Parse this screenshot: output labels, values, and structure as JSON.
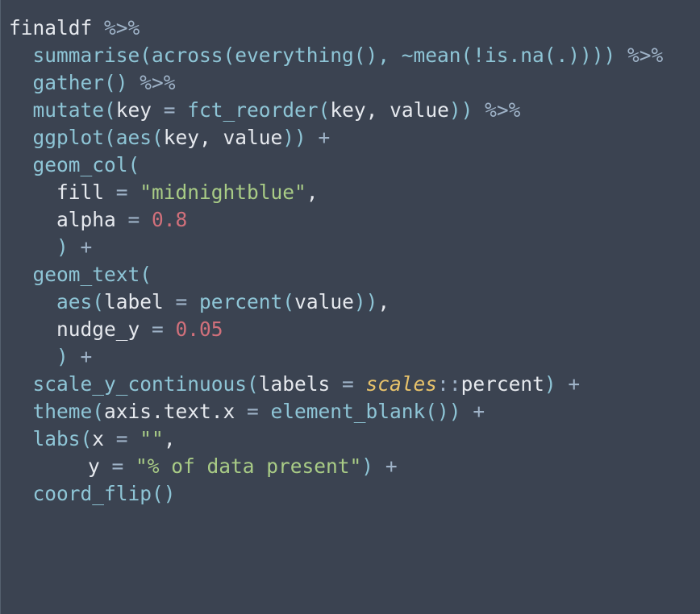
{
  "editor": {
    "colors": {
      "background": "#3b4351",
      "plain": "#e6e9ee",
      "function": "#8ec5d6",
      "operator": "#9fb3c8",
      "string": "#a9cc86",
      "number": "#d1707b",
      "namespace": "#e8c36b"
    },
    "lines": [
      {
        "indent": 0,
        "tokens": [
          {
            "t": "plain",
            "v": "finaldf "
          },
          {
            "t": "op",
            "v": "%>%"
          }
        ]
      },
      {
        "indent": 1,
        "tokens": [
          {
            "t": "fn",
            "v": "summarise(across(everything(), ~mean(!is.na(.)))) "
          },
          {
            "t": "op",
            "v": "%>%"
          }
        ]
      },
      {
        "indent": 1,
        "tokens": [
          {
            "t": "fn",
            "v": "gather() "
          },
          {
            "t": "op",
            "v": "%>%"
          }
        ]
      },
      {
        "indent": 1,
        "tokens": [
          {
            "t": "fn",
            "v": "mutate("
          },
          {
            "t": "plain",
            "v": "key "
          },
          {
            "t": "op",
            "v": "= "
          },
          {
            "t": "fn",
            "v": "fct_reorder("
          },
          {
            "t": "plain",
            "v": "key, value"
          },
          {
            "t": "fn",
            "v": ")) "
          },
          {
            "t": "op",
            "v": "%>%"
          }
        ]
      },
      {
        "indent": 1,
        "tokens": [
          {
            "t": "fn",
            "v": "ggplot(aes("
          },
          {
            "t": "plain",
            "v": "key, value"
          },
          {
            "t": "fn",
            "v": ")) "
          },
          {
            "t": "op",
            "v": "+"
          }
        ]
      },
      {
        "indent": 1,
        "tokens": [
          {
            "t": "fn",
            "v": "geom_col("
          }
        ]
      },
      {
        "indent": 2,
        "tokens": [
          {
            "t": "plain",
            "v": "fill "
          },
          {
            "t": "op",
            "v": "= "
          },
          {
            "t": "str",
            "v": "\"midnightblue\""
          },
          {
            "t": "plain",
            "v": ","
          }
        ]
      },
      {
        "indent": 2,
        "tokens": [
          {
            "t": "plain",
            "v": "alpha "
          },
          {
            "t": "op",
            "v": "= "
          },
          {
            "t": "num",
            "v": "0.8"
          }
        ]
      },
      {
        "indent": 2,
        "tokens": [
          {
            "t": "fn",
            "v": ") "
          },
          {
            "t": "op",
            "v": "+"
          }
        ]
      },
      {
        "indent": 1,
        "tokens": [
          {
            "t": "fn",
            "v": "geom_text("
          }
        ]
      },
      {
        "indent": 2,
        "tokens": [
          {
            "t": "fn",
            "v": "aes("
          },
          {
            "t": "plain",
            "v": "label "
          },
          {
            "t": "op",
            "v": "= "
          },
          {
            "t": "fn",
            "v": "percent("
          },
          {
            "t": "plain",
            "v": "value"
          },
          {
            "t": "fn",
            "v": "))"
          },
          {
            "t": "plain",
            "v": ","
          }
        ]
      },
      {
        "indent": 2,
        "tokens": [
          {
            "t": "plain",
            "v": "nudge_y "
          },
          {
            "t": "op",
            "v": "= "
          },
          {
            "t": "num",
            "v": "0.05"
          }
        ]
      },
      {
        "indent": 2,
        "tokens": [
          {
            "t": "fn",
            "v": ") "
          },
          {
            "t": "op",
            "v": "+"
          }
        ]
      },
      {
        "indent": 1,
        "tokens": [
          {
            "t": "fn",
            "v": "scale_y_continuous("
          },
          {
            "t": "plain",
            "v": "labels "
          },
          {
            "t": "op",
            "v": "= "
          },
          {
            "t": "ns",
            "v": "scales"
          },
          {
            "t": "op",
            "v": "::"
          },
          {
            "t": "plain",
            "v": "percent"
          },
          {
            "t": "fn",
            "v": ") "
          },
          {
            "t": "op",
            "v": "+"
          }
        ]
      },
      {
        "indent": 1,
        "tokens": [
          {
            "t": "fn",
            "v": "theme("
          },
          {
            "t": "plain",
            "v": "axis.text.x "
          },
          {
            "t": "op",
            "v": "= "
          },
          {
            "t": "fn",
            "v": "element_blank()) "
          },
          {
            "t": "op",
            "v": "+"
          }
        ]
      },
      {
        "indent": 1,
        "tokens": [
          {
            "t": "fn",
            "v": "labs("
          },
          {
            "t": "plain",
            "v": "x "
          },
          {
            "t": "op",
            "v": "= "
          },
          {
            "t": "str",
            "v": "\"\""
          },
          {
            "t": "plain",
            "v": ","
          }
        ]
      },
      {
        "indent": 3,
        "tokens": [
          {
            "t": "plain",
            "v": "y "
          },
          {
            "t": "op",
            "v": "= "
          },
          {
            "t": "str",
            "v": "\"% of data present\""
          },
          {
            "t": "fn",
            "v": ") "
          },
          {
            "t": "op",
            "v": "+"
          }
        ]
      },
      {
        "indent": 1,
        "tokens": [
          {
            "t": "fn",
            "v": "coord_flip()"
          }
        ]
      }
    ]
  }
}
